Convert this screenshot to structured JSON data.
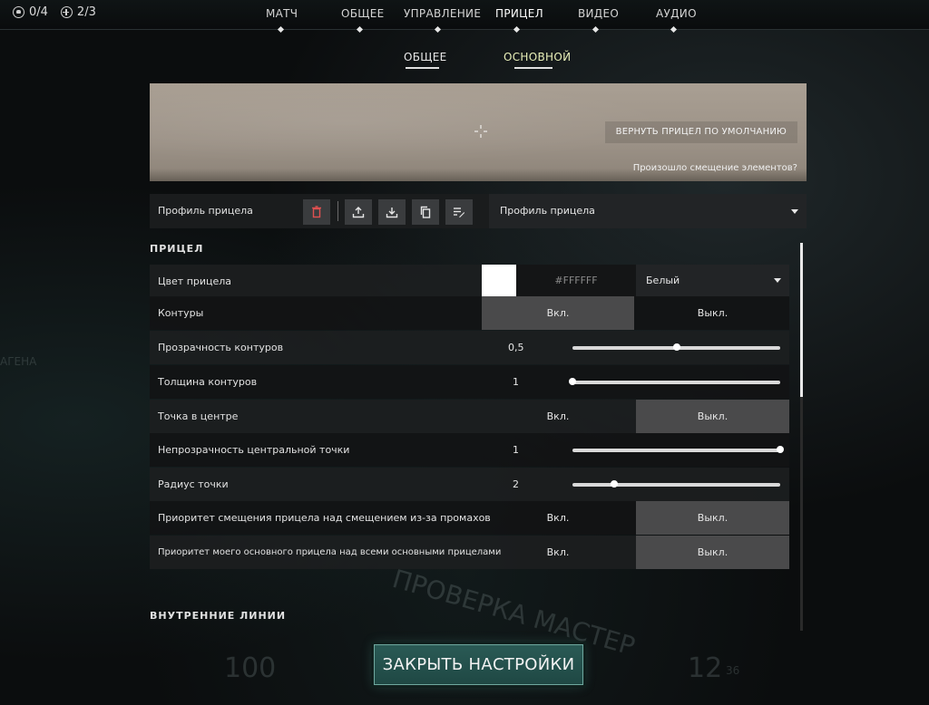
{
  "counters": {
    "first": "0/4",
    "second": "2/3"
  },
  "nav": {
    "tabs": [
      "МАТЧ",
      "ОБЩЕЕ",
      "УПРАВЛЕНИЕ",
      "ПРИЦЕЛ",
      "ВИДЕО",
      "АУДИО"
    ],
    "active": "ПРИЦЕЛ"
  },
  "subnav": {
    "tabs": [
      "ОБЩЕЕ",
      "ОСНОВНОЙ"
    ],
    "active": "ОСНОВНОЙ"
  },
  "preview": {
    "reset_label": "ВЕРНУТЬ ПРИЦЕЛ ПО УМОЛЧАНИЮ",
    "misaligned_label": "Произошло смещение элементов?"
  },
  "profile": {
    "label": "Профиль прицела",
    "dropdown_value": "Профиль прицела"
  },
  "section_crosshair": "ПРИЦЕЛ",
  "crosshair": {
    "color_label": "Цвет прицела",
    "color_hex_placeholder": "#FFFFFF",
    "color_value": "Белый",
    "swatch_color": "#FFFFFF",
    "outlines_label": "Контуры",
    "outline_opacity_label": "Прозрачность контуров",
    "outline_opacity_value": "0,5",
    "outline_opacity_fraction": 0.5,
    "outline_thickness_label": "Толщина контуров",
    "outline_thickness_value": "1",
    "outline_thickness_fraction": 0.0,
    "center_dot_label": "Точка в центре",
    "center_dot_opacity_label": "Непрозрачность центральной точки",
    "center_dot_opacity_value": "1",
    "center_dot_opacity_fraction": 1.0,
    "dot_radius_label": "Радиус точки",
    "dot_radius_value": "2",
    "dot_radius_fraction": 0.2,
    "firing_error_label": "Приоритет смещения прицела над смещением из-за промахов",
    "primary_override_label": "Приоритет моего основного прицела над всеми основными прицелами"
  },
  "toggle": {
    "on": "Вкл.",
    "off": "Выкл."
  },
  "states": {
    "outlines": "on",
    "center_dot": "off",
    "firing_error": "off",
    "primary_override": "off"
  },
  "section_inner": "ВНУТРЕННИЕ ЛИНИИ",
  "close_label": "ЗАКРЫТЬ НАСТРОЙКИ",
  "background": {
    "left_text": "АГЕНА",
    "banner": "ПРОВЕРКА МАСТЕР",
    "health": "100",
    "ammo": "12",
    "ammo_reserve": "36"
  },
  "colors": {
    "accent_selected": "#e8efb8",
    "close_button": "#2a5a55"
  },
  "icons": [
    "delete-icon",
    "export-icon",
    "import-icon",
    "copy-icon",
    "rename-icon"
  ]
}
